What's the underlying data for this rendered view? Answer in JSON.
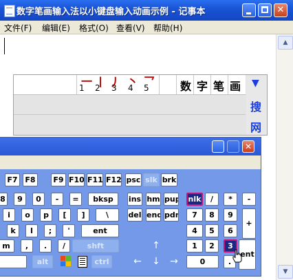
{
  "window": {
    "title": "数字笔画输入法以小键盘输入动画示例 - 记事本",
    "controls": {
      "minimize": "",
      "maximize": "",
      "close": "✕"
    }
  },
  "menu": [
    "文件(F)",
    "编辑(E)",
    "格式(O)",
    "查看(V)",
    "帮助(H)"
  ],
  "ime": {
    "strokes": [
      {
        "glyph": "一",
        "num": "1"
      },
      {
        "glyph": "丨",
        "num": "2"
      },
      {
        "glyph": "丿",
        "num": "3"
      },
      {
        "glyph": "丶",
        "num": "4"
      },
      {
        "glyph": "乛",
        "num": "5"
      }
    ],
    "title_chars": [
      "数",
      "字",
      "笔",
      "画"
    ],
    "side": {
      "arrow": "▼",
      "search": "搜",
      "net": "网"
    }
  },
  "keyboard": {
    "close_label": "✕",
    "fkeys": [
      "F7",
      "F8",
      "F9",
      "F10",
      "F11",
      "F12",
      "psc",
      "slk",
      "brk"
    ],
    "row2": [
      "8",
      "9",
      "0",
      "-",
      "=",
      "bksp",
      "ins",
      "hm",
      "pup",
      "nlk",
      "/",
      "*",
      "-"
    ],
    "row3": [
      "i",
      "o",
      "p",
      "[",
      "]",
      "\\",
      "del",
      "end",
      "pdn",
      "7",
      "8",
      "9",
      "+"
    ],
    "row4": [
      "k",
      "l",
      ";",
      "'",
      "ent",
      "4",
      "5",
      "6"
    ],
    "row5": [
      "m",
      ",",
      ".",
      "/",
      "shft",
      "1",
      "2",
      "3",
      "ent"
    ],
    "row6": [
      "alt",
      "ctrl",
      "0",
      "."
    ],
    "arrows": {
      "up": "↑",
      "left": "←",
      "down": "↓",
      "right": "→"
    }
  },
  "colors": {
    "titlebar": "#1a54d6",
    "keyboard_bg": "#7399e8",
    "ime_accent": "#1a3ee0",
    "stroke_red": "#c00000",
    "active_key": "#1a2680"
  }
}
